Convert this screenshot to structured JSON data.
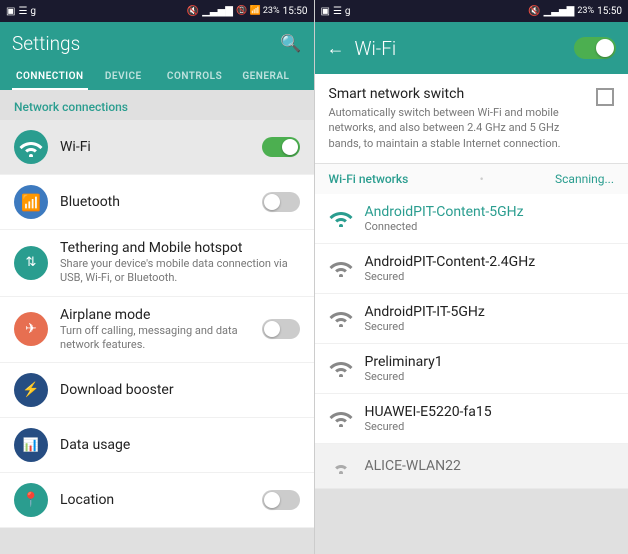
{
  "left": {
    "status": {
      "icons_left": "▣ ☰ g",
      "signal": "📵 📶 23%",
      "time": "15:50"
    },
    "title": "Settings",
    "search_icon": "🔍",
    "tabs": [
      {
        "label": "CONNECTION",
        "active": true
      },
      {
        "label": "DEVICE",
        "active": false
      },
      {
        "label": "CONTROLS",
        "active": false
      },
      {
        "label": "GENERAL",
        "active": false
      }
    ],
    "section": "Network connections",
    "items": [
      {
        "name": "wifi-item",
        "icon": "wifi",
        "icon_color": "teal",
        "title": "Wi-Fi",
        "subtitle": "",
        "toggle": true,
        "toggle_on": true,
        "highlighted": true
      },
      {
        "name": "bluetooth-item",
        "icon": "B",
        "icon_color": "blue",
        "title": "Bluetooth",
        "subtitle": "",
        "toggle": true,
        "toggle_on": false,
        "highlighted": false
      },
      {
        "name": "tethering-item",
        "icon": "⇅",
        "icon_color": "teal",
        "title": "Tethering and Mobile hotspot",
        "subtitle": "Share your device's mobile data connection via USB, Wi-Fi, or Bluetooth.",
        "toggle": false,
        "highlighted": false
      },
      {
        "name": "airplane-item",
        "icon": "✈",
        "icon_color": "orange",
        "title": "Airplane mode",
        "subtitle": "Turn off calling, messaging and data network features.",
        "toggle": true,
        "toggle_on": false,
        "highlighted": false
      },
      {
        "name": "download-item",
        "icon": "⚡",
        "icon_color": "darkblue",
        "title": "Download booster",
        "subtitle": "",
        "toggle": false,
        "highlighted": false
      },
      {
        "name": "data-usage-item",
        "icon": "📊",
        "icon_color": "darkblue",
        "title": "Data usage",
        "subtitle": "",
        "toggle": false,
        "highlighted": false
      },
      {
        "name": "location-item",
        "icon": "📍",
        "icon_color": "teal",
        "title": "Location",
        "subtitle": "",
        "toggle": true,
        "toggle_on": false,
        "highlighted": false
      }
    ]
  },
  "right": {
    "status": {
      "time": "15:50"
    },
    "title": "Wi-Fi",
    "smart_switch": {
      "title": "Smart network switch",
      "description": "Automatically switch between Wi-Fi and mobile networks, and also between 2.4 GHz and 5 GHz bands, to maintain a stable Internet connection."
    },
    "networks_label": "Wi-Fi networks",
    "scanning_label": "Scanning...",
    "networks": [
      {
        "name": "AndroidPIT-Content-5GHz",
        "status": "Connected",
        "connected": true
      },
      {
        "name": "AndroidPIT-Content-2.4GHz",
        "status": "Secured",
        "connected": false
      },
      {
        "name": "AndroidPIT-IT-5GHz",
        "status": "Secured",
        "connected": false
      },
      {
        "name": "Preliminary1",
        "status": "Secured",
        "connected": false
      },
      {
        "name": "HUAWEI-E5220-fa15",
        "status": "Secured",
        "connected": false
      },
      {
        "name": "ALICE-WLAN22",
        "status": "...",
        "connected": false
      }
    ]
  }
}
